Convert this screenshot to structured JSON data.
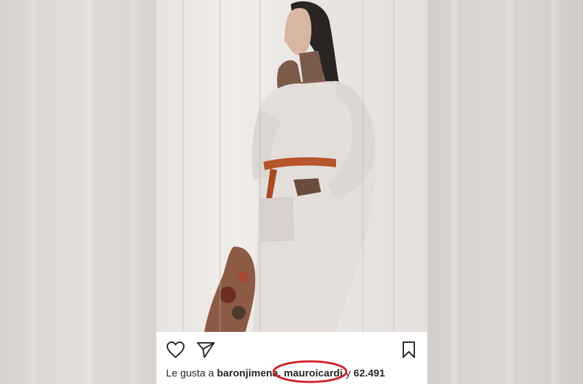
{
  "post": {
    "icons": {
      "like": "heart-outline-icon",
      "share": "paper-plane-icon",
      "save": "bookmark-icon"
    },
    "likes": {
      "prefix": "Le gusta a",
      "user1": "baronjimena",
      "separator": ",",
      "user2": "mauroicardi",
      "conjunction": "y",
      "count": "62.491"
    }
  },
  "colors": {
    "highlight": "#d0202a",
    "text": "#262626"
  }
}
